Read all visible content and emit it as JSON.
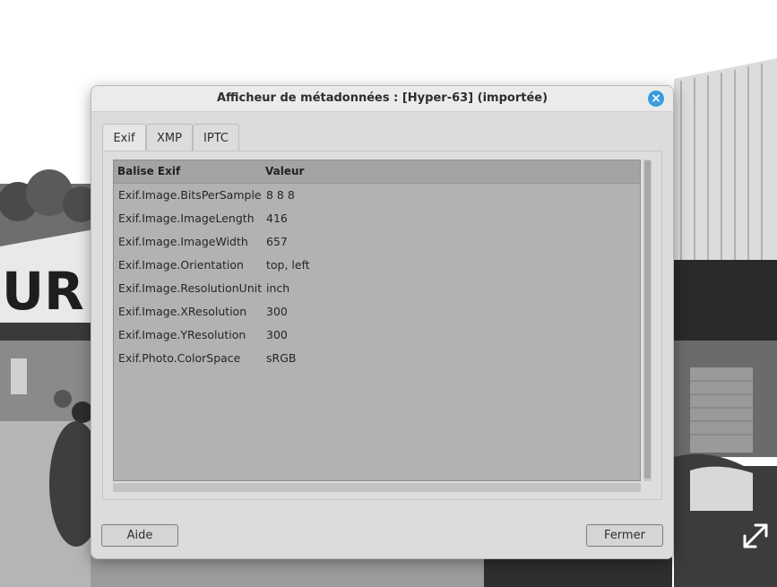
{
  "dialog": {
    "title": "Afficheur de métadonnées : [Hyper-63] (importée)",
    "close_icon": "close-icon"
  },
  "tabs": [
    {
      "label": "Exif",
      "active": true
    },
    {
      "label": "XMP",
      "active": false
    },
    {
      "label": "IPTC",
      "active": false
    }
  ],
  "table": {
    "headers": {
      "key": "Balise Exif",
      "value": "Valeur"
    },
    "rows": [
      {
        "key": "Exif.Image.BitsPerSample",
        "value": "8 8 8"
      },
      {
        "key": "Exif.Image.ImageLength",
        "value": "416"
      },
      {
        "key": "Exif.Image.ImageWidth",
        "value": "657"
      },
      {
        "key": "Exif.Image.Orientation",
        "value": "top, left"
      },
      {
        "key": "Exif.Image.ResolutionUnit",
        "value": "inch"
      },
      {
        "key": "Exif.Image.XResolution",
        "value": "300"
      },
      {
        "key": "Exif.Image.YResolution",
        "value": "300"
      },
      {
        "key": "Exif.Photo.ColorSpace",
        "value": "sRGB"
      }
    ]
  },
  "buttons": {
    "help_label": "Aide",
    "close_label": "Fermer"
  },
  "photo": {
    "sign_text": "UR",
    "expand_icon": "expand-icon"
  },
  "colors": {
    "close_button": "#3a9be0",
    "dialog_bg": "#dcdcdc",
    "list_bg": "#b2b2b2"
  }
}
